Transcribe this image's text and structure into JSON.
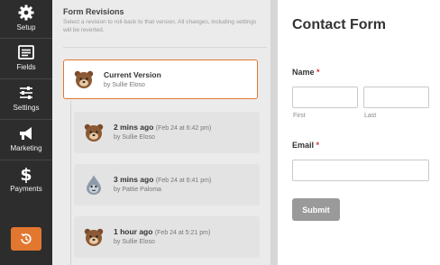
{
  "sidebar": {
    "items": [
      {
        "label": "Setup",
        "icon": "gear-icon"
      },
      {
        "label": "Fields",
        "icon": "fields-icon"
      },
      {
        "label": "Settings",
        "icon": "sliders-icon"
      },
      {
        "label": "Marketing",
        "icon": "megaphone-icon"
      },
      {
        "label": "Payments",
        "icon": "dollar-icon"
      }
    ],
    "revert_icon": "revisions-icon",
    "accent": "#e27730"
  },
  "revisions": {
    "title": "Form Revisions",
    "description": "Select a revision to roll-back to that version. All changes, including settings will be reverted.",
    "current": {
      "title": "Current Version",
      "author": "by Sullie Eloso"
    },
    "items": [
      {
        "title": "2 mins ago",
        "when": "(Feb 24 at 6:42 pm)",
        "author": "by Sullie Eloso"
      },
      {
        "title": "3 mins ago",
        "when": "(Feb 24 at 6:41 pm)",
        "author": "by Pattie Paloma"
      },
      {
        "title": "1 hour ago",
        "when": "(Feb 24 at 5:21 pm)",
        "author": "by Sullie Eloso"
      }
    ]
  },
  "form": {
    "title": "Contact Form",
    "name_label": "Name",
    "first_label": "First",
    "last_label": "Last",
    "email_label": "Email",
    "required_mark": "*",
    "submit_label": "Submit"
  }
}
